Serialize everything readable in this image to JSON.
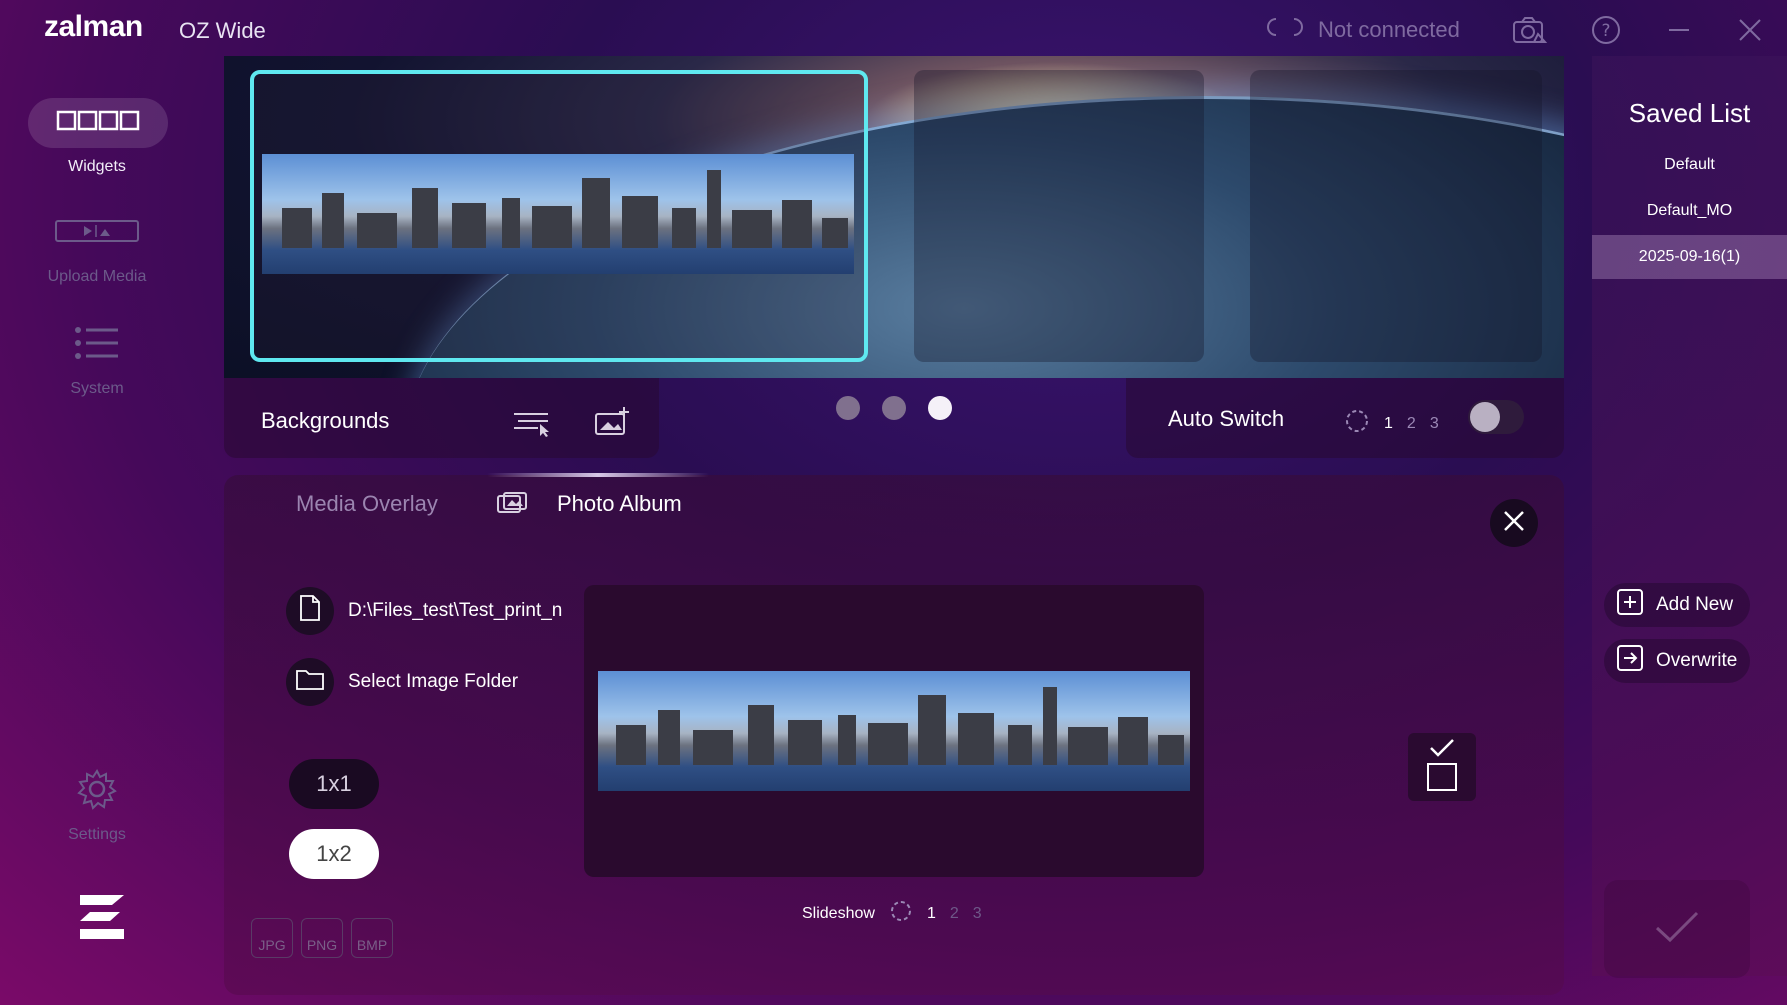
{
  "app": {
    "brand": "zalman",
    "title": "OZ Wide",
    "status": "Not connected"
  },
  "sidebar": {
    "items": [
      {
        "label": "Widgets",
        "active": true
      },
      {
        "label": "Upload Media",
        "active": false
      },
      {
        "label": "System",
        "active": false
      },
      {
        "label": "Settings",
        "active": false
      }
    ]
  },
  "backgrounds": {
    "label": "Backgrounds",
    "pages": 3,
    "current_page": 3
  },
  "auto_switch": {
    "label": "Auto Switch",
    "numbers": [
      "1",
      "2",
      "3"
    ],
    "selected": "1",
    "enabled": false
  },
  "tabs": {
    "media_overlay": "Media Overlay",
    "photo_album": "Photo Album"
  },
  "photo_album": {
    "file_path": "D:\\Files_test\\Test_print_n",
    "select_folder": "Select Image Folder",
    "layout_1x1": "1x1",
    "layout_1x2": "1x2",
    "selected_layout": "1x2",
    "slideshow_label": "Slideshow",
    "slideshow_numbers": [
      "1",
      "2",
      "3"
    ],
    "formats": [
      "JPG",
      "PNG",
      "BMP"
    ]
  },
  "saved_list": {
    "title": "Saved List",
    "items": [
      "Default",
      "Default_MO",
      "2025-09-16(1)"
    ],
    "selected": "2025-09-16(1)",
    "add_new": "Add New",
    "overwrite": "Overwrite"
  },
  "colors": {
    "accent_cyan": "#5fe8f0",
    "muted": "#7f6aa0"
  }
}
